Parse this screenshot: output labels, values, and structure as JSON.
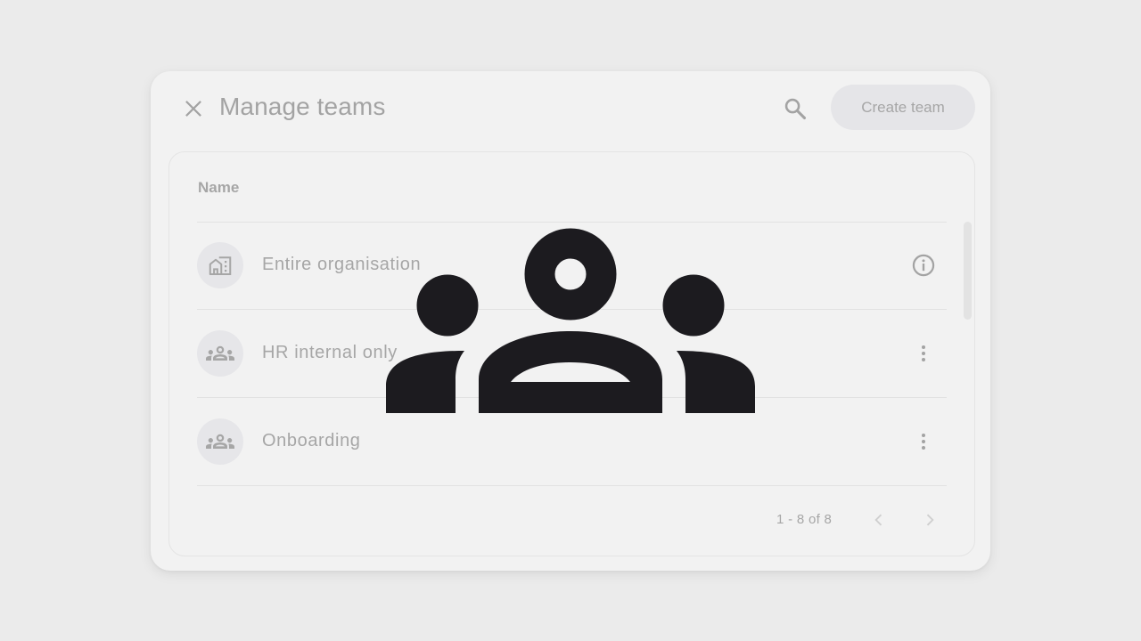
{
  "dialog": {
    "title": "Manage teams",
    "create_button_label": "Create team",
    "icons": {
      "close": "close-icon",
      "search": "search-icon"
    }
  },
  "table": {
    "column_header": "Name",
    "rows": [
      {
        "label": "Entire organisation",
        "avatar_icon": "domain-icon",
        "action_icon": "info-icon"
      },
      {
        "label": "HR internal only",
        "avatar_icon": "groups-icon",
        "action_icon": "more-vert-icon"
      },
      {
        "label": "Onboarding",
        "avatar_icon": "groups-icon",
        "action_icon": "more-vert-icon"
      }
    ]
  },
  "pagination": {
    "range_text": "1 - 8 of 8",
    "icons": {
      "prev": "chevron-left-icon",
      "next": "chevron-right-icon"
    }
  },
  "overlay": {
    "icon": "groups-icon"
  },
  "colors": {
    "background": "#ebebeb",
    "dialog": "#f2f2f2",
    "muted_text": "#a6a6a6",
    "overlay_icon": "#1c1b1f"
  }
}
